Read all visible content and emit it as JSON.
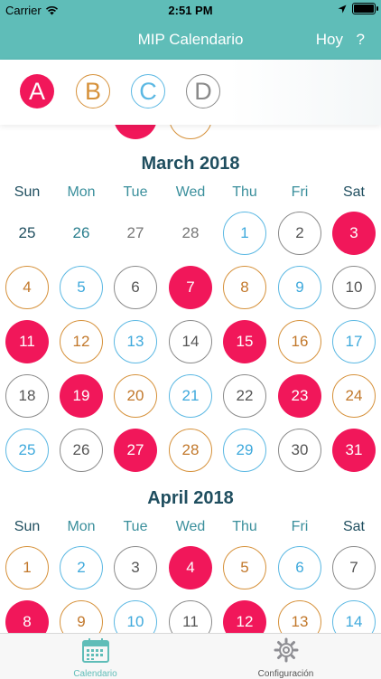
{
  "status": {
    "carrier": "Carrier",
    "time": "2:51 PM"
  },
  "nav": {
    "title": "MIP Calendario",
    "today": "Hoy",
    "help": "?"
  },
  "legend": [
    "A",
    "B",
    "C",
    "D"
  ],
  "colors": {
    "A": "#f1175a",
    "B": "#d6913a",
    "C": "#5bb8e3",
    "D": "#8a8a8a",
    "nav": "#5fbdb8",
    "title": "#1f4e5f"
  },
  "weekdays": [
    "Sun",
    "Mon",
    "Tue",
    "Wed",
    "Thu",
    "Fri",
    "Sat"
  ],
  "months": [
    {
      "name": "March 2018",
      "weeks": [
        [
          [
            "25",
            ""
          ],
          [
            "26",
            ""
          ],
          [
            "27",
            ""
          ],
          [
            "28",
            ""
          ],
          [
            "1",
            "C"
          ],
          [
            "2",
            "D"
          ],
          [
            "3",
            "A"
          ]
        ],
        [
          [
            "4",
            "B"
          ],
          [
            "5",
            "C"
          ],
          [
            "6",
            "D"
          ],
          [
            "7",
            "A"
          ],
          [
            "8",
            "B"
          ],
          [
            "9",
            "C"
          ],
          [
            "10",
            "D"
          ]
        ],
        [
          [
            "11",
            "A"
          ],
          [
            "12",
            "B"
          ],
          [
            "13",
            "C"
          ],
          [
            "14",
            "D"
          ],
          [
            "15",
            "A"
          ],
          [
            "16",
            "B"
          ],
          [
            "17",
            "C"
          ]
        ],
        [
          [
            "18",
            "D"
          ],
          [
            "19",
            "A"
          ],
          [
            "20",
            "B"
          ],
          [
            "21",
            "C"
          ],
          [
            "22",
            "D"
          ],
          [
            "23",
            "A"
          ],
          [
            "24",
            "B"
          ]
        ],
        [
          [
            "25",
            "C"
          ],
          [
            "26",
            "D"
          ],
          [
            "27",
            "A"
          ],
          [
            "28",
            "B"
          ],
          [
            "29",
            "C"
          ],
          [
            "30",
            "D"
          ],
          [
            "31",
            "A"
          ]
        ]
      ]
    },
    {
      "name": "April 2018",
      "weeks": [
        [
          [
            "1",
            "B"
          ],
          [
            "2",
            "C"
          ],
          [
            "3",
            "D"
          ],
          [
            "4",
            "A"
          ],
          [
            "5",
            "B"
          ],
          [
            "6",
            "C"
          ],
          [
            "7",
            "D"
          ]
        ],
        [
          [
            "8",
            "A"
          ],
          [
            "9",
            "B"
          ],
          [
            "10",
            "C"
          ],
          [
            "11",
            "D"
          ],
          [
            "12",
            "A"
          ],
          [
            "13",
            "B"
          ],
          [
            "14",
            "C"
          ]
        ]
      ]
    }
  ],
  "tabs": {
    "calendar": "Calendario",
    "settings": "Configuración"
  }
}
